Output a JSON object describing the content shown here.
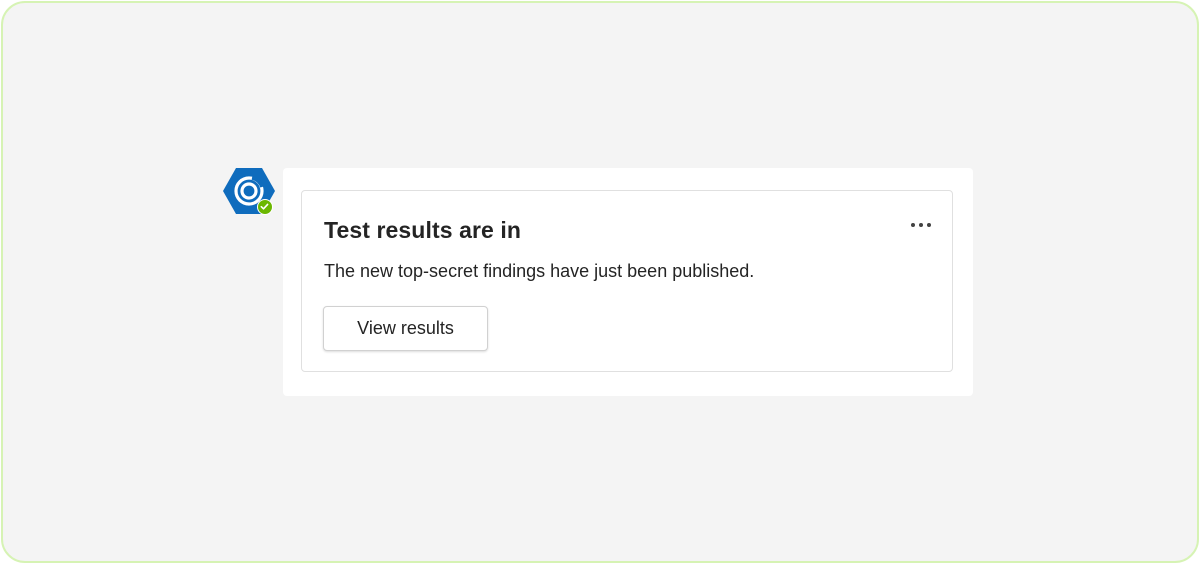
{
  "bot": {
    "avatar_icon": "hexagon-ring-logo-icon",
    "avatar_color": "#0f6cbd",
    "presence_status": "available",
    "presence_color": "#6bb700"
  },
  "card": {
    "title": "Test results are in",
    "body": "The new top-secret findings have just been published.",
    "more_icon": "more-options-icon",
    "action_label": "View results"
  },
  "colors": {
    "frame_border": "#d6f3b4",
    "background": "#f4f4f4",
    "text": "#242424"
  }
}
